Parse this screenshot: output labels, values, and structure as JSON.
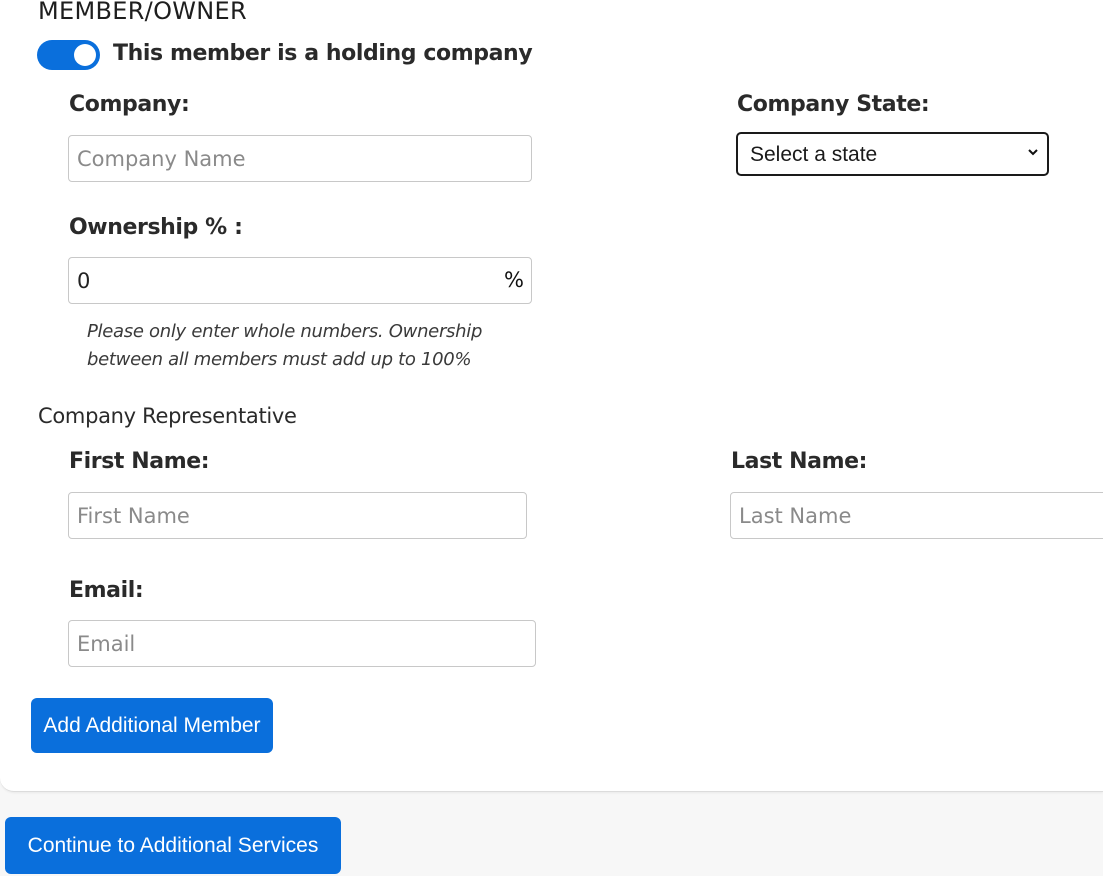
{
  "section": {
    "title": "MEMBER/OWNER",
    "holding_toggle": {
      "label": "This member is a holding company",
      "on": true
    }
  },
  "company": {
    "label": "Company:",
    "placeholder": "Company Name",
    "value": ""
  },
  "company_state": {
    "label": "Company State:",
    "selected": "Select a state"
  },
  "ownership": {
    "label": "Ownership % :",
    "value": "0",
    "suffix": "%",
    "help": "Please only enter whole numbers. Ownership between all members must add up to 100%"
  },
  "representative": {
    "heading": "Company Representative",
    "first_name": {
      "label": "First Name:",
      "placeholder": "First Name",
      "value": ""
    },
    "last_name": {
      "label": "Last Name:",
      "placeholder": "Last Name",
      "value": ""
    },
    "email": {
      "label": "Email:",
      "placeholder": "Email",
      "value": ""
    }
  },
  "buttons": {
    "add_member": "Add Additional Member",
    "continue": "Continue to Additional Services"
  },
  "colors": {
    "accent": "#0a6fdc",
    "background": "#f7f7f7",
    "card": "#ffffff"
  }
}
